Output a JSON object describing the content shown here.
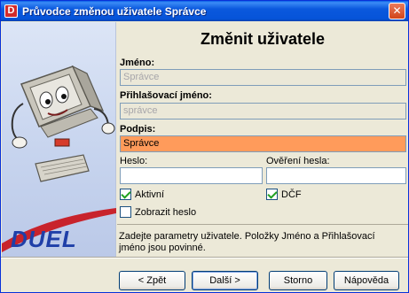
{
  "window": {
    "title": "Průvodce změnou uživatele Správce",
    "app_icon_letter": "D",
    "close_glyph": "✕"
  },
  "branding": {
    "logo_text": "DUEL"
  },
  "form": {
    "title": "Změnit uživatele",
    "name": {
      "label": "Jméno:",
      "value": "Správce"
    },
    "login": {
      "label": "Přihlašovací jméno:",
      "value": "správce"
    },
    "signature": {
      "label": "Podpis:",
      "value": "Správce"
    },
    "password": {
      "label": "Heslo:",
      "value": ""
    },
    "password_confirm": {
      "label": "Ověření hesla:",
      "value": ""
    },
    "active": {
      "label": "Aktivní",
      "checked": true
    },
    "dcf": {
      "label": "DČF",
      "checked": true
    },
    "show_password": {
      "label": "Zobrazit heslo",
      "checked": false
    },
    "hint": "Zadejte parametry uživatele. Položky Jméno a Přihlašovací jméno jsou povinné."
  },
  "buttons": {
    "back": "< Zpět",
    "next": "Další >",
    "cancel": "Storno",
    "help": "Nápověda"
  },
  "colors": {
    "titlebar": "#0A58DD",
    "highlight_field": "#FF9B5B",
    "logo": "#1F3FA8",
    "panel": "#C7D4EE"
  }
}
